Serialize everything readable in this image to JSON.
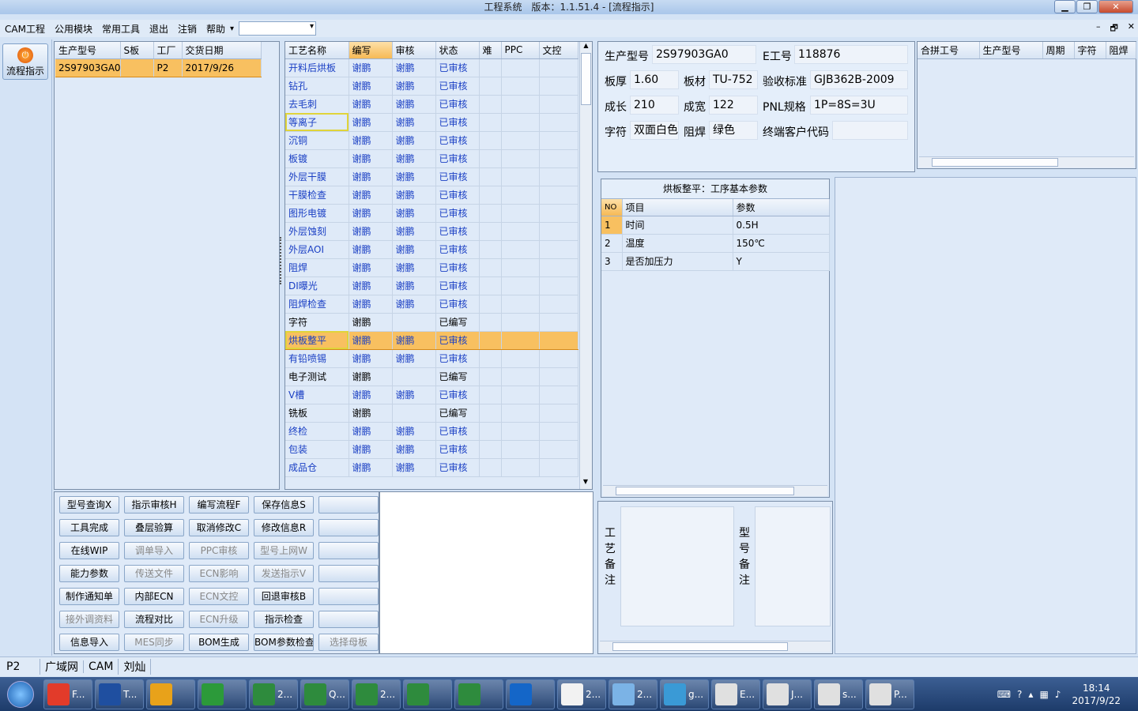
{
  "window": {
    "title": "工程系统　版本：1.1.51.4 - [流程指示]",
    "min": "▁",
    "max": "❐",
    "close": "✕"
  },
  "menu": {
    "items": [
      "CAM工程",
      "公用模块",
      "常用工具",
      "退出",
      "注销",
      "帮助"
    ],
    "help_arrow": "▾",
    "combo_value": ""
  },
  "mdi": {
    "min": "–",
    "restore": "🗗",
    "close": "✕"
  },
  "sidebar": {
    "flow_button": "流程指示"
  },
  "orders": {
    "headers": [
      "生产型号",
      "S板",
      "工厂",
      "交货日期"
    ],
    "rows": [
      {
        "model": "2S97903GA0",
        "s": "",
        "factory": "P2",
        "date": "2017/9/26"
      }
    ]
  },
  "process": {
    "headers": [
      "工艺名称",
      "编写",
      "审核",
      "状态",
      "难",
      "PPC",
      "文控"
    ],
    "rows": [
      {
        "name": "开料后烘板",
        "writer": "谢鹏",
        "reviewer": "谢鹏",
        "status": "已审核"
      },
      {
        "name": "钻孔",
        "writer": "谢鹏",
        "reviewer": "谢鹏",
        "status": "已审核"
      },
      {
        "name": "去毛刺",
        "writer": "谢鹏",
        "reviewer": "谢鹏",
        "status": "已审核"
      },
      {
        "name": "等离子",
        "writer": "谢鹏",
        "reviewer": "谢鹏",
        "status": "已审核"
      },
      {
        "name": "沉铜",
        "writer": "谢鹏",
        "reviewer": "谢鹏",
        "status": "已审核"
      },
      {
        "name": "板镀",
        "writer": "谢鹏",
        "reviewer": "谢鹏",
        "status": "已审核"
      },
      {
        "name": "外层干膜",
        "writer": "谢鹏",
        "reviewer": "谢鹏",
        "status": "已审核"
      },
      {
        "name": "干膜检查",
        "writer": "谢鹏",
        "reviewer": "谢鹏",
        "status": "已审核"
      },
      {
        "name": "图形电镀",
        "writer": "谢鹏",
        "reviewer": "谢鹏",
        "status": "已审核"
      },
      {
        "name": "外层蚀刻",
        "writer": "谢鹏",
        "reviewer": "谢鹏",
        "status": "已审核"
      },
      {
        "name": "外层AOI",
        "writer": "谢鹏",
        "reviewer": "谢鹏",
        "status": "已审核"
      },
      {
        "name": "阻焊",
        "writer": "谢鹏",
        "reviewer": "谢鹏",
        "status": "已审核"
      },
      {
        "name": "DI曝光",
        "writer": "谢鹏",
        "reviewer": "谢鹏",
        "status": "已审核"
      },
      {
        "name": "阻焊检查",
        "writer": "谢鹏",
        "reviewer": "谢鹏",
        "status": "已审核"
      },
      {
        "name": "字符",
        "writer": "谢鹏",
        "reviewer": "",
        "status": "已编写"
      },
      {
        "name": "烘板整平",
        "writer": "谢鹏",
        "reviewer": "谢鹏",
        "status": "已审核"
      },
      {
        "name": "有铅喷锡",
        "writer": "谢鹏",
        "reviewer": "谢鹏",
        "status": "已审核"
      },
      {
        "name": "电子测试",
        "writer": "谢鹏",
        "reviewer": "",
        "status": "已编写"
      },
      {
        "name": "V槽",
        "writer": "谢鹏",
        "reviewer": "谢鹏",
        "status": "已审核"
      },
      {
        "name": "铣板",
        "writer": "谢鹏",
        "reviewer": "",
        "status": "已编写"
      },
      {
        "name": "终检",
        "writer": "谢鹏",
        "reviewer": "谢鹏",
        "status": "已审核"
      },
      {
        "name": "包装",
        "writer": "谢鹏",
        "reviewer": "谢鹏",
        "status": "已审核"
      },
      {
        "name": "成品仓",
        "writer": "谢鹏",
        "reviewer": "谢鹏",
        "status": "已审核"
      }
    ]
  },
  "buttons": [
    [
      "型号查询X",
      "指示审核H",
      "编写流程F",
      "保存信息S",
      ""
    ],
    [
      "工具完成",
      "叠层验算",
      "取消修改C",
      "修改信息R",
      ""
    ],
    [
      "在线WIP",
      "调单导入",
      "PPC审核",
      "型号上网W",
      ""
    ],
    [
      "能力参数",
      "传送文件",
      "ECN影响",
      "发送指示V",
      ""
    ],
    [
      "制作通知单",
      "内部ECN",
      "ECN文控",
      "回退审核B",
      ""
    ],
    [
      "接外调资料",
      "流程对比",
      "ECN升级",
      "指示检查",
      ""
    ],
    [
      "信息导入",
      "MES同步",
      "BOM生成",
      "BOM参数检查",
      "选择母板"
    ]
  ],
  "disabled_buttons": [
    "调单导入",
    "PPC审核",
    "型号上网W",
    "传送文件",
    "ECN影响",
    "发送指示V",
    "ECN文控",
    "接外调资料",
    "ECN升级",
    "MES同步",
    "选择母板"
  ],
  "info": {
    "model_label": "生产型号",
    "model": "2S97903GA0",
    "eno_label": "E工号",
    "eno": "118876",
    "thick_label": "板厚",
    "thick": "1.60",
    "material_label": "板材",
    "material": "TU-752",
    "std_label": "验收标准",
    "std": "GJB362B-2009",
    "len_label": "成长",
    "len": "210",
    "wid_label": "成宽",
    "wid": "122",
    "pnl_label": "PNL规格",
    "pnl": "1P=8S=3U",
    "char_label": "字符",
    "char": "双面白色",
    "mask_label": "阻焊",
    "mask": "绿色",
    "cust_label": "终端客户代码",
    "cust": ""
  },
  "merge": {
    "headers": [
      "合拼工号",
      "生产型号",
      "周期",
      "字符",
      "阻焊"
    ]
  },
  "params": {
    "title": "烘板整平：工序基本参数",
    "headers": [
      "NO",
      "项目",
      "参数"
    ],
    "rows": [
      [
        "1",
        "时间",
        "0.5H"
      ],
      [
        "2",
        "温度",
        "150℃"
      ],
      [
        "3",
        "是否加压力",
        "Y"
      ]
    ]
  },
  "remarks": {
    "process_label": [
      "工",
      "艺",
      "备",
      "注"
    ],
    "model_label": [
      "型",
      "号",
      "备",
      "注"
    ]
  },
  "status": {
    "factory": "P2",
    "items": [
      "广域网",
      "CAM",
      "刘灿"
    ]
  },
  "taskbar": {
    "apps": [
      "F...",
      "T...",
      "",
      "",
      "2...",
      "Q...",
      "2...",
      "",
      "",
      "",
      "2...",
      "2...",
      "g...",
      "E...",
      "J...",
      "s...",
      "P..."
    ],
    "time": "18:14",
    "date": "2017/9/22"
  }
}
